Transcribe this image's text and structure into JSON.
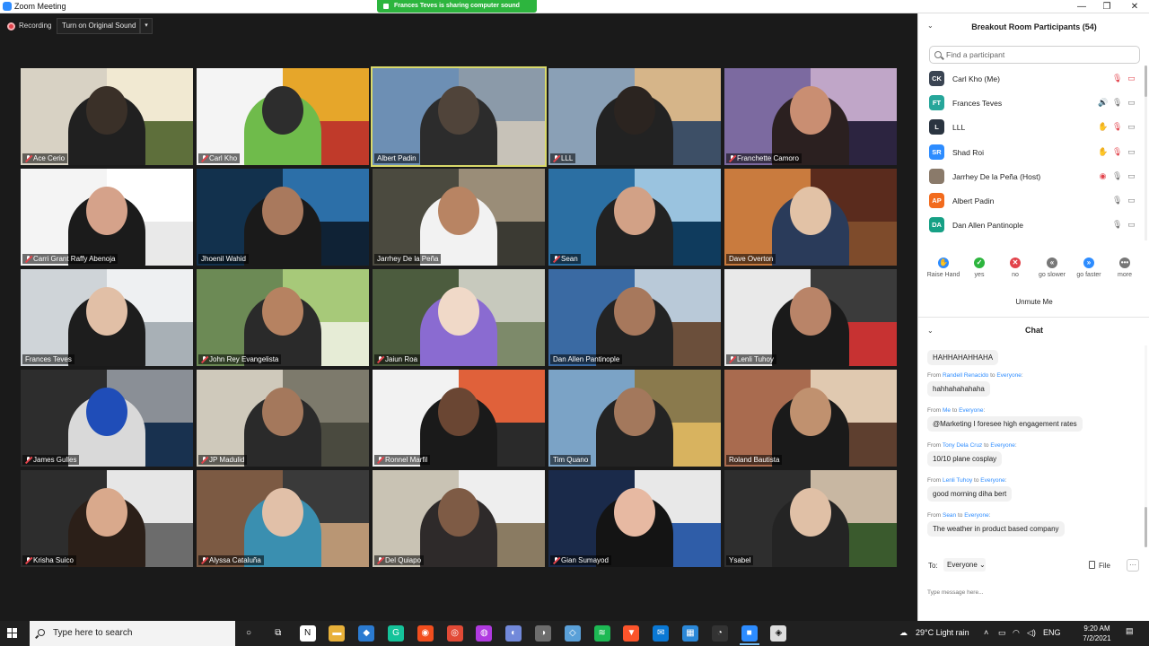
{
  "window": {
    "title": "Zoom Meeting",
    "minimize": "—",
    "restore": "❐",
    "close": "✕"
  },
  "banner": {
    "text": "Frances Teves is sharing computer sound"
  },
  "topbar": {
    "recording": "Recording",
    "original_sound": "Turn on Original Sound",
    "caret": "▾"
  },
  "participants_tiles": [
    {
      "name": "Ace Cerio",
      "muted": true,
      "colors": [
        "#d8d2c4",
        "#f1e9d2",
        "#5e6f3b",
        "#3a3028",
        "#202020"
      ]
    },
    {
      "name": "Carl Kho",
      "muted": true,
      "colors": [
        "#f4f4f4",
        "#e6a62a",
        "#c03a2a",
        "#2d2d2d",
        "#6fbb4b"
      ]
    },
    {
      "name": "Albert Padin",
      "muted": false,
      "active": true,
      "colors": [
        "#6d8fb4",
        "#8b9aa9",
        "#c7c2b8",
        "#50443a",
        "#2c2c2c"
      ]
    },
    {
      "name": "LLL",
      "muted": true,
      "colors": [
        "#8aa0b6",
        "#d6b589",
        "#3d4f66",
        "#2b2420",
        "#222"
      ]
    },
    {
      "name": "Franchette Camoro",
      "muted": true,
      "colors": [
        "#7c6aa0",
        "#c0a6c8",
        "#2c2440",
        "#c98e72",
        "#2b2020"
      ]
    },
    {
      "name": "Carri Grant Raffy Abenoja",
      "muted": true,
      "colors": [
        "#f4f4f4",
        "#ffffff",
        "#e9e9e9",
        "#d5a28a",
        "#1b1b1b"
      ]
    },
    {
      "name": "Jhoenil Wahid",
      "muted": false,
      "colors": [
        "#12314d",
        "#2c6fa8",
        "#0f2235",
        "#a9795d",
        "#1a1a1a"
      ]
    },
    {
      "name": "Jarrhey De la Peña",
      "muted": false,
      "colors": [
        "#4b4a3f",
        "#9a8d78",
        "#3b3a33",
        "#b88463",
        "#f2f2f2"
      ]
    },
    {
      "name": "Sean",
      "muted": true,
      "colors": [
        "#2b6fa3",
        "#9ac3df",
        "#0f3b5d",
        "#d2a186",
        "#222"
      ]
    },
    {
      "name": "Dave Overton",
      "muted": false,
      "colors": [
        "#c97b3e",
        "#5a2b1d",
        "#7e4b2b",
        "#e2c2a6",
        "#2a3b5a"
      ]
    },
    {
      "name": "Frances Teves",
      "muted": false,
      "colors": [
        "#cfd4d8",
        "#eef0f2",
        "#a8b0b6",
        "#e1bfa6",
        "#1d1d1d"
      ]
    },
    {
      "name": "John Rey Evangelista",
      "muted": true,
      "colors": [
        "#6c8a55",
        "#a7c979",
        "#e6ecd6",
        "#b68261",
        "#2a2a2a"
      ]
    },
    {
      "name": "Jaiun Roa",
      "muted": true,
      "colors": [
        "#4c5c3e",
        "#c7c9bd",
        "#7d8a6a",
        "#f0d9c8",
        "#8a6bd1"
      ]
    },
    {
      "name": "Dan Allen Pantinople",
      "muted": false,
      "colors": [
        "#3a6aa3",
        "#b9c9d8",
        "#6b4f3b",
        "#a7785c",
        "#232323"
      ]
    },
    {
      "name": "Lenli Tuhoy",
      "muted": true,
      "colors": [
        "#e9e9e9",
        "#3b3b3b",
        "#c73232",
        "#b98468",
        "#1a1a1a"
      ]
    },
    {
      "name": "James Gulles",
      "muted": true,
      "colors": [
        "#2d2d2d",
        "#8a8f96",
        "#18314f",
        "#1f4db8",
        "#d9d9d9"
      ]
    },
    {
      "name": "JP Madulid",
      "muted": true,
      "colors": [
        "#cfc9bb",
        "#7d7a6c",
        "#4a4a3f",
        "#a4785c",
        "#2a2a2a"
      ]
    },
    {
      "name": "Ronnel Marfil",
      "muted": true,
      "colors": [
        "#f2f2f2",
        "#e0613a",
        "#2a2a2a",
        "#6a4633",
        "#1a1a1a"
      ]
    },
    {
      "name": "Tim Quano",
      "muted": false,
      "colors": [
        "#7ba3c6",
        "#8a7a4d",
        "#d8b35f",
        "#a3785c",
        "#232323"
      ]
    },
    {
      "name": "Roland Bautista",
      "muted": false,
      "colors": [
        "#a96b4f",
        "#e0c9b0",
        "#5e3f2f",
        "#c0916f",
        "#1a1a1a"
      ]
    },
    {
      "name": "Krisha Suico",
      "muted": true,
      "colors": [
        "#2d2d2d",
        "#e6e6e6",
        "#6c6c6c",
        "#d9a98c",
        "#2b1f18"
      ]
    },
    {
      "name": "Alyssa Cataluña",
      "muted": true,
      "colors": [
        "#7c5a43",
        "#3a3a3a",
        "#b99674",
        "#e1c0a8",
        "#3a8fb0"
      ]
    },
    {
      "name": "Del Quiapo",
      "muted": true,
      "colors": [
        "#c9c3b4",
        "#eeeeee",
        "#8a7b62",
        "#7e5b45",
        "#2e2a2a"
      ]
    },
    {
      "name": "Gian Sumayod",
      "muted": true,
      "colors": [
        "#1a2a4a",
        "#e8e8e8",
        "#2f5da8",
        "#e7b9a2",
        "#141414"
      ]
    },
    {
      "name": "Ysabel",
      "muted": false,
      "colors": [
        "#2e2e2e",
        "#c8b7a2",
        "#3a5a2d",
        "#e0c0a6",
        "#242424"
      ]
    }
  ],
  "panel": {
    "title": "Breakout Room Participants (54)",
    "search_placeholder": "Find a participant",
    "participants": [
      {
        "initials": "CK",
        "name": "Carl Kho (Me)",
        "color": "#3a4452",
        "icons": [
          "mic-off",
          "video-off"
        ]
      },
      {
        "initials": "FT",
        "name": "Frances Teves",
        "color": "#26a69a",
        "icons": [
          "audio-share",
          "mic-on",
          "video-on"
        ]
      },
      {
        "initials": "L",
        "name": "LLL",
        "color": "#2a3440",
        "icons": [
          "raise-hand",
          "mic-off",
          "video-on"
        ]
      },
      {
        "initials": "SR",
        "name": "Shad Roi",
        "color": "#2d8cff",
        "icons": [
          "raise-hand",
          "mic-off",
          "video-on"
        ]
      },
      {
        "initials": "",
        "name": "Jarrhey De la Peña (Host)",
        "color": "#8a7a6a",
        "icons": [
          "record",
          "mic-on",
          "video-on"
        ]
      },
      {
        "initials": "AP",
        "name": "Albert Padin",
        "color": "#f26b1d",
        "icons": [
          "mic-on",
          "video-on"
        ]
      },
      {
        "initials": "DA",
        "name": "Dan Allen Pantinople",
        "color": "#16a085",
        "icons": [
          "mic-on",
          "video-on"
        ]
      }
    ],
    "reactions": [
      {
        "label": "Raise Hand",
        "symbol": "✋",
        "color": "#2d8cff"
      },
      {
        "label": "yes",
        "symbol": "✓",
        "color": "#2db53e"
      },
      {
        "label": "no",
        "symbol": "✕",
        "color": "#e2434b"
      },
      {
        "label": "go slower",
        "symbol": "«",
        "color": "#777777"
      },
      {
        "label": "go faster",
        "symbol": "»",
        "color": "#2d8cff"
      },
      {
        "label": "more",
        "symbol": "•••",
        "color": "#777777"
      }
    ],
    "unmute": "Unmute Me",
    "chat_title": "Chat"
  },
  "chat": {
    "first_bubble": "HAHHAHAHHAHA",
    "messages": [
      {
        "from": "Randell Renacido",
        "to": "Everyone",
        "text": "hahhahahahaha"
      },
      {
        "from": "Me",
        "to": "Everyone",
        "text": "@Marketing I foresee high engagement rates"
      },
      {
        "from": "Tony Dela Cruz",
        "to": "Everyone",
        "text": "10/10 plane cosplay"
      },
      {
        "from": "Lenli Tuhoy",
        "to": "Everyone",
        "text": "good morning diha bert"
      },
      {
        "from": "Sean",
        "to": "Everyone",
        "text": "The weather in product based company"
      }
    ],
    "from_word": "From",
    "to_word": "to",
    "to_label": "To:",
    "to_value": "Everyone",
    "file": "File",
    "more": "···",
    "placeholder": "Type message here..."
  },
  "taskbar": {
    "search_placeholder": "Type here to search",
    "weather": "29°C  Light rain",
    "lang": "ENG",
    "time": "9:20 AM",
    "date": "7/2/2021",
    "apps": [
      {
        "name": "cortana-icon",
        "symbol": "○",
        "color": "transparent"
      },
      {
        "name": "task-view-icon",
        "symbol": "⧉",
        "color": "transparent"
      },
      {
        "name": "notion-icon",
        "symbol": "N",
        "color": "#ffffff"
      },
      {
        "name": "file-explorer-icon",
        "symbol": "▬",
        "color": "#e8b13a"
      },
      {
        "name": "vscode-icon",
        "symbol": "◆",
        "color": "#2b7bd1"
      },
      {
        "name": "grammarly-icon",
        "symbol": "G",
        "color": "#15c39a"
      },
      {
        "name": "figma-icon",
        "symbol": "◉",
        "color": "#f24e1e"
      },
      {
        "name": "chrome-icon",
        "symbol": "◎",
        "color": "#e24a36"
      },
      {
        "name": "messenger-icon",
        "symbol": "◍",
        "color": "#b03ae0"
      },
      {
        "name": "discord-icon",
        "symbol": "◐",
        "color": "#7289da"
      },
      {
        "name": "app-icon",
        "symbol": "◑",
        "color": "#6d6d6d"
      },
      {
        "name": "notes-icon",
        "symbol": "◇",
        "color": "#5aa0d8"
      },
      {
        "name": "spotify-icon",
        "symbol": "≋",
        "color": "#1db954"
      },
      {
        "name": "brave-icon",
        "symbol": "▼",
        "color": "#fb542b"
      },
      {
        "name": "mail-icon",
        "symbol": "✉",
        "color": "#0a78d4"
      },
      {
        "name": "calendar-icon",
        "symbol": "▦",
        "color": "#2b88d8"
      },
      {
        "name": "clock-icon",
        "symbol": "◔",
        "color": "#333333"
      },
      {
        "name": "zoom-icon",
        "symbol": "■",
        "color": "#2d8cff"
      },
      {
        "name": "extra-app-icon",
        "symbol": "◈",
        "color": "#dddddd"
      }
    ]
  }
}
